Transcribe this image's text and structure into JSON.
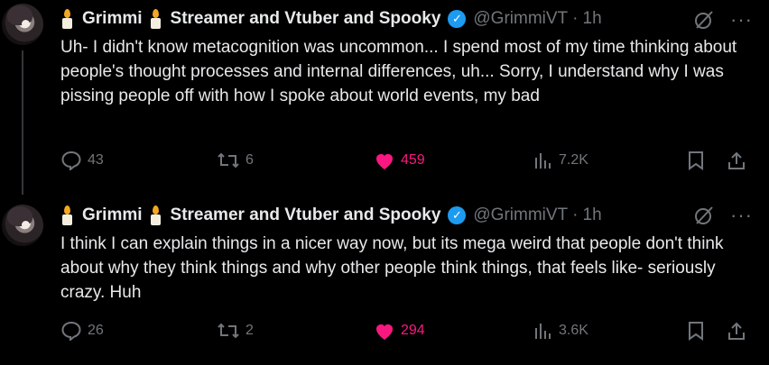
{
  "colors": {
    "accent_like": "#f91880",
    "muted": "#71767b",
    "verified": "#1d9bf0",
    "background": "#000000"
  },
  "icons": {
    "candle": "candle-emoji",
    "grok": "grok-icon",
    "more": "more-icon",
    "reply": "reply-icon",
    "repost": "repost-icon",
    "like": "heart-icon",
    "views": "views-icon",
    "bookmark": "bookmark-icon",
    "share": "share-icon"
  },
  "tweets": [
    {
      "display_name_part1": "Grimmi",
      "display_name_part2": "Streamer and Vtuber and Spooky",
      "handle": "@GrimmiVT",
      "separator": "·",
      "time": "1h",
      "text": "Uh- I didn't know metacognition was uncommon... I spend most of my time thinking about people's thought processes and internal differences, uh... Sorry, I understand why I was pissing people off with how I spoke about world events, my bad",
      "replies": "43",
      "reposts": "6",
      "likes": "459",
      "views": "7.2K"
    },
    {
      "display_name_part1": "Grimmi",
      "display_name_part2": "Streamer and Vtuber and Spooky",
      "handle": "@GrimmiVT",
      "separator": "·",
      "time": "1h",
      "text": "I think I can explain things in a nicer way now, but its mega weird that people don't think about why they think things and why other people think things, that feels like- seriously crazy. Huh",
      "replies": "26",
      "reposts": "2",
      "likes": "294",
      "views": "3.6K"
    }
  ]
}
